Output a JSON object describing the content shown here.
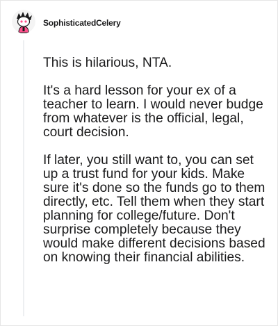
{
  "comment": {
    "username": "SophisticatedCelery",
    "avatar": "snoo-avatar-icon",
    "paragraphs": [
      "This is hilarious, NTA.",
      "It's a hard lesson for your ex of a teacher to learn. I would never budge from whatever is the official, legal, court decision.",
      "If later, you still want to, you can set up a trust fund for your kids. Make sure it's done so the funds go to them directly, etc. Tell them when they start planning for college/future. Don't surprise completely because they would make different decisions based on knowing their financial abilities."
    ]
  },
  "colors": {
    "text": "#1a1a1b",
    "thread_line": "#edeff1",
    "avatar_accent": "#ff4f8b",
    "avatar_dark": "#1a1a1b"
  }
}
